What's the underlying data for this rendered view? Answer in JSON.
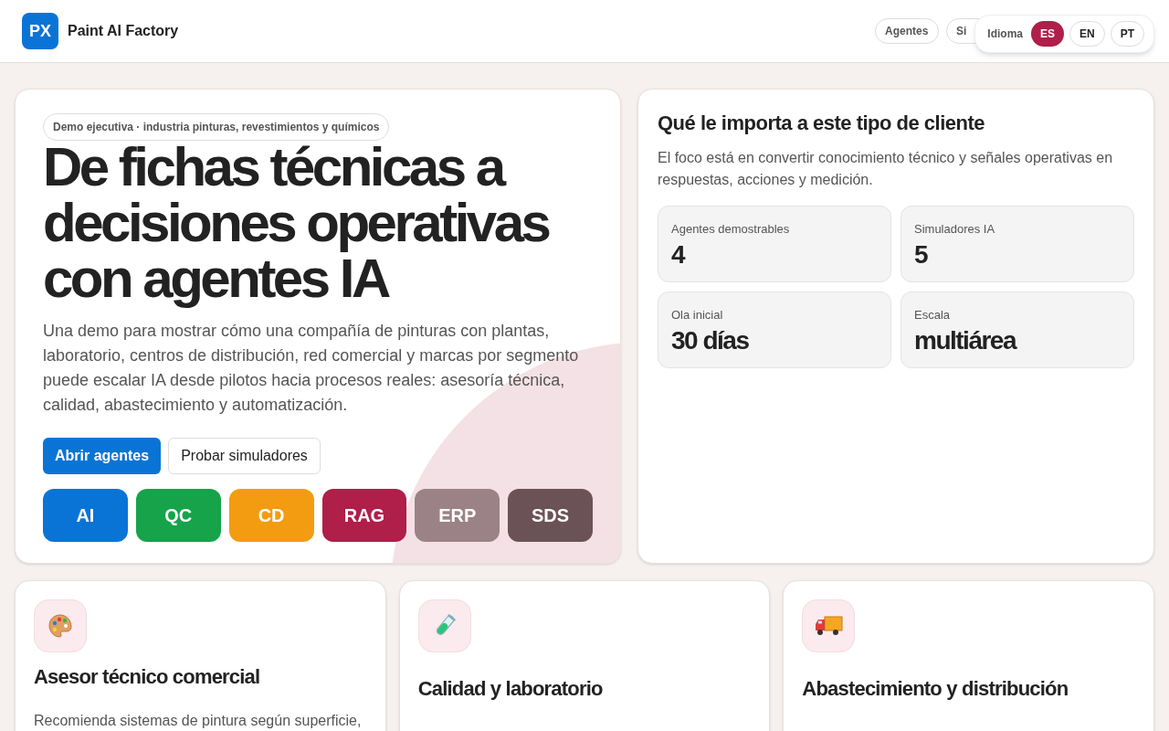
{
  "header": {
    "logo": "PX",
    "title": "Paint AI Factory",
    "nav": [
      {
        "label": "Agentes"
      },
      {
        "label": "Si"
      }
    ],
    "language": {
      "label": "Idioma",
      "options": [
        {
          "label": "ES",
          "selected": true
        },
        {
          "label": "EN",
          "selected": false
        },
        {
          "label": "PT",
          "selected": false
        }
      ]
    }
  },
  "hero": {
    "badge": "Demo ejecutiva · industria pinturas, revestimientos y químicos",
    "title": "De fichas técnicas a decisiones operativas con agentes IA",
    "description": "Una demo para mostrar cómo una compañía de pinturas con plantas, laboratorio, centros de distribución, red comercial y marcas por segmento puede escalar IA desde pilotos hacia procesos reales: asesoría técnica, calidad, abastecimiento y automatización.",
    "buttons": [
      {
        "label": "Abrir agentes",
        "kind": "primary"
      },
      {
        "label": "Probar simuladores",
        "kind": "secondary"
      }
    ],
    "chips": [
      {
        "label": "AI",
        "color": "#0a74d6"
      },
      {
        "label": "QC",
        "color": "#16a34a"
      },
      {
        "label": "CD",
        "color": "#f39c12"
      },
      {
        "label": "RAG",
        "color": "#b01e4a"
      },
      {
        "label": "ERP",
        "color": "#9b8286"
      },
      {
        "label": "SDS",
        "color": "#6b5257"
      }
    ]
  },
  "client_panel": {
    "title": "Qué le importa a este tipo de cliente",
    "description": "El foco está en convertir conocimiento técnico y señales operativas en respuestas, acciones y medición.",
    "stats": [
      {
        "label": "Agentes demostrables",
        "value": "4"
      },
      {
        "label": "Simuladores IA",
        "value": "5"
      },
      {
        "label": "Ola inicial",
        "value": "30 días"
      },
      {
        "label": "Escala",
        "value": "multiárea"
      }
    ]
  },
  "cards": [
    {
      "kind": "palette",
      "title": "Asesor técnico comercial",
      "description": "Recomienda sistemas de pintura según superficie,"
    },
    {
      "kind": "test-tube",
      "title": "Calidad y laboratorio"
    },
    {
      "kind": "truck",
      "title": "Abastecimiento y distribución"
    }
  ]
}
